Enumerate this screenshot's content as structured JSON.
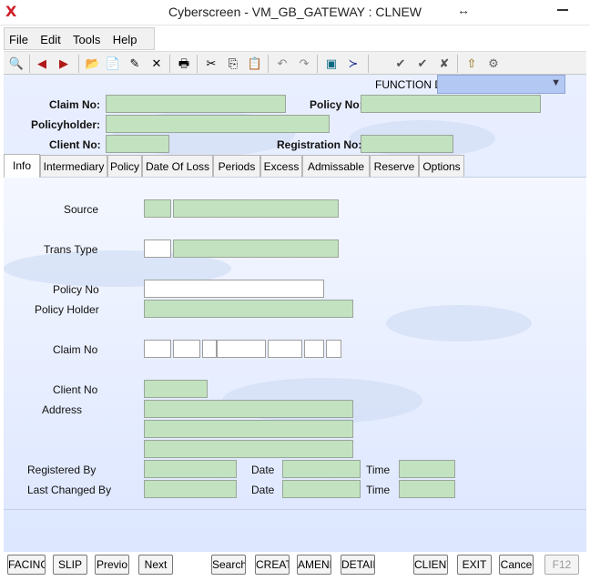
{
  "window": {
    "title": "Cyberscreen - VM_GB_GATEWAY : CLNEW",
    "logo_glyph": "X",
    "resize_glyph": "↔"
  },
  "menu": [
    "File",
    "Edit",
    "Tools",
    "Help"
  ],
  "toolbar_icons": [
    "binoculars-icon",
    "back-arrow-icon",
    "forward-arrow-icon",
    "new-folder-icon",
    "document-icon",
    "pen-icon",
    "delete-x-icon",
    "printer-icon",
    "cut-icon",
    "copy-icon",
    "paste-icon",
    "undo-icon",
    "redo-icon",
    "monitor-icon",
    "console-icon",
    "check-icon",
    "check-all-icon",
    "cancel-check-icon",
    "folder-up-icon",
    "settings-icon"
  ],
  "toolbar_glyphs": [
    "🔍",
    "◀",
    "▶",
    "📂",
    "📄",
    "✎",
    "✕",
    "🖶",
    "✂",
    "⎘",
    "📋",
    "↶",
    "↷",
    "▣",
    "≻",
    "✔",
    "✔",
    "✘",
    "⇧",
    "⚙"
  ],
  "header": {
    "function_label": "FUNCTION D",
    "function_value": "",
    "claim_no_label": "Claim No:",
    "claim_no": "",
    "policy_no_label": "Policy No:",
    "policy_no": "",
    "policyholder_label": "Policyholder:",
    "policyholder": "",
    "client_no_label": "Client No:",
    "client_no": "",
    "registration_no_label": "Registration No:",
    "registration_no": ""
  },
  "tabs": [
    "Info",
    "Intermediary",
    "Policy",
    "Date Of Loss",
    "Periods",
    "Excess",
    "Admissable",
    "Reserve",
    "Options"
  ],
  "active_tab": "Info",
  "info": {
    "source_label": "Source",
    "trans_type_label": "Trans Type",
    "policy_no_label": "Policy No",
    "policy_holder_label": "Policy Holder",
    "claim_no_label": "Claim No",
    "client_no_label": "Client No",
    "address_label": "Address",
    "registered_by_label": "Registered By",
    "last_changed_by_label": "Last Changed By",
    "date_label": "Date",
    "time_label": "Time"
  },
  "buttons": [
    "FACING",
    "SLIP",
    "Previo",
    "Next",
    "Search",
    "CREAT",
    "AMEND",
    "DETAIL",
    "CLIENT",
    "EXIT",
    "Cance",
    "F12"
  ],
  "colors": {
    "field_green": "#c2e2c0",
    "function_blue": "#b3c8f2",
    "background": "#e3ebff"
  }
}
